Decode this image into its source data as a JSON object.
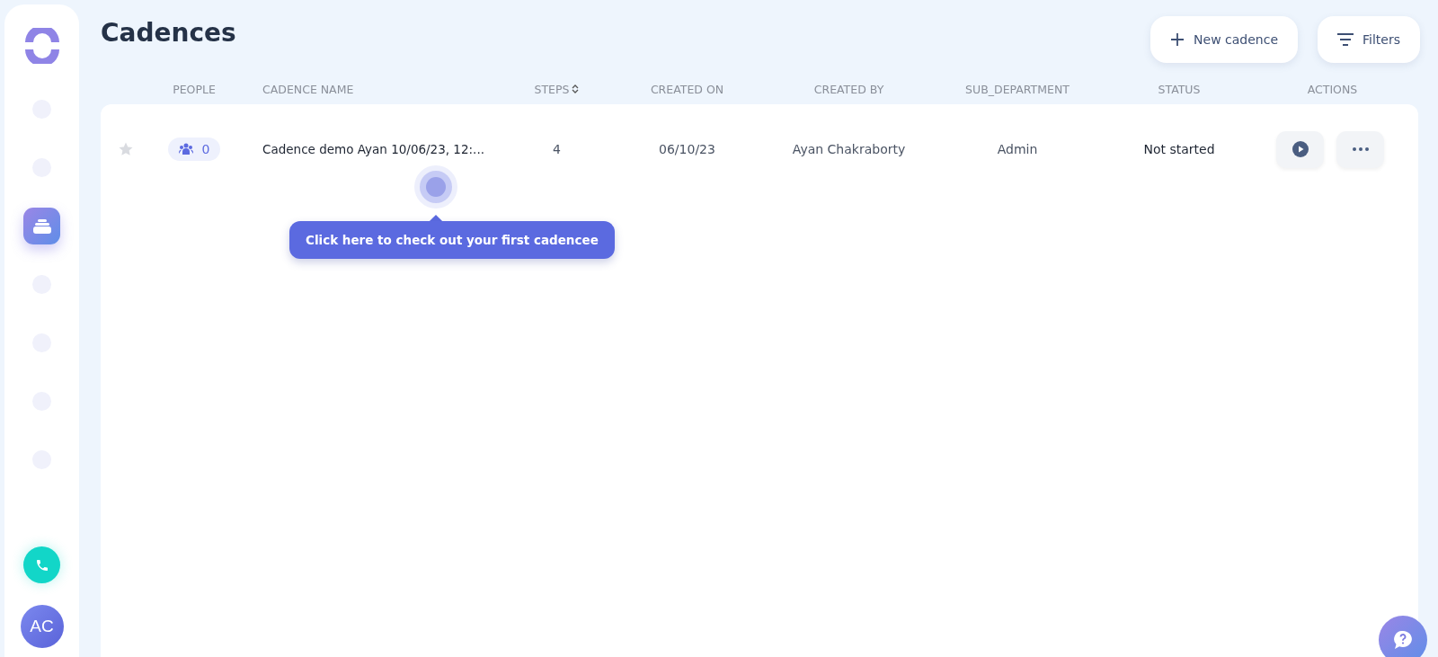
{
  "sidebar": {
    "items": [
      {
        "selected": false
      },
      {
        "selected": false
      },
      {
        "selected": true
      },
      {
        "selected": false
      },
      {
        "selected": false
      },
      {
        "selected": false
      },
      {
        "selected": false
      }
    ],
    "avatar": "AC"
  },
  "page": {
    "title": "Cadences",
    "buttons": [
      {
        "kind": "new",
        "label": "New cadence"
      },
      {
        "kind": "filter",
        "label": "Filters"
      }
    ]
  },
  "table": {
    "columns": [
      {
        "label": "PEOPLE",
        "sortable": false
      },
      {
        "label": "CADENCE NAME",
        "sortable": false
      },
      {
        "label": "STEPS",
        "sortable": true
      },
      {
        "label": "CREATED ON",
        "sortable": false
      },
      {
        "label": "CREATED BY",
        "sortable": false
      },
      {
        "label": "SUB_DEPARTMENT",
        "sortable": false
      },
      {
        "label": "STATUS",
        "sortable": false
      },
      {
        "label": "ACTIONS",
        "sortable": false
      }
    ],
    "rows": [
      {
        "starred": false,
        "people": "0",
        "name": "Cadence demo Ayan 10/06/23, 12:...",
        "steps": "4",
        "created_on": "06/10/23",
        "created_by": "Ayan Chakraborty",
        "sub_department": "Admin",
        "status": "Not started"
      }
    ]
  },
  "tooltip": {
    "text": "Click here to check out your first cadencee"
  }
}
